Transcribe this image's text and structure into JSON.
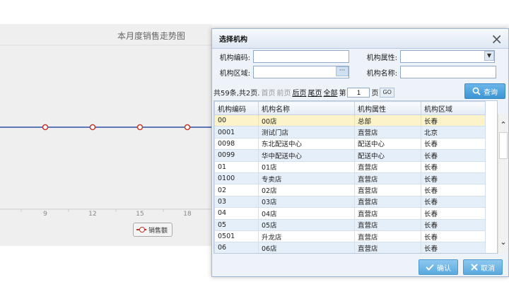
{
  "chart": {
    "title": "本月度销售走势图",
    "x_ticks": [
      "9",
      "12",
      "15",
      "18"
    ],
    "legend_label": "销售额",
    "series_color": "#c23531",
    "line_color": "#5b77b8"
  },
  "dialog": {
    "title": "选择机构",
    "close_icon": "×",
    "fields": {
      "code": {
        "label": "机构编码:",
        "value": ""
      },
      "attribute": {
        "label": "机构属性:",
        "value": ""
      },
      "region": {
        "label": "机构区域:",
        "value": "",
        "button": "···"
      },
      "name": {
        "label": "机构名称:",
        "value": ""
      }
    },
    "pager": {
      "summary": "共59条,共2页.",
      "first": "首页",
      "prev": "前页",
      "next": "后页",
      "last": "尾页",
      "all": "全部",
      "page_prefix": "第",
      "page_value": "1",
      "page_suffix": "页",
      "go": "GO"
    },
    "search_label": "查询",
    "table": {
      "headers": [
        "机构编码",
        "机构名称",
        "机构属性",
        "机构区域"
      ],
      "rows": [
        [
          "00",
          "00店",
          "总部",
          "长春"
        ],
        [
          "0001",
          "测试门店",
          "直营店",
          "北京"
        ],
        [
          "0098",
          "东北配送中心",
          "配送中心",
          "长春"
        ],
        [
          "0099",
          "华中配送中心",
          "配送中心",
          "长春"
        ],
        [
          "01",
          "01店",
          "直营店",
          "长春"
        ],
        [
          "0100",
          "专卖店",
          "直营店",
          "长春"
        ],
        [
          "02",
          "02店",
          "直营店",
          "长春"
        ],
        [
          "03",
          "03店",
          "直营店",
          "长春"
        ],
        [
          "04",
          "04店",
          "直营店",
          "长春"
        ],
        [
          "05",
          "05店",
          "直营店",
          "长春"
        ],
        [
          "0501",
          "升龙店",
          "直营店",
          "长春"
        ],
        [
          "06",
          "06店",
          "直营店",
          "长春"
        ]
      ]
    },
    "confirm_label": "确认",
    "cancel_label": "取消"
  }
}
